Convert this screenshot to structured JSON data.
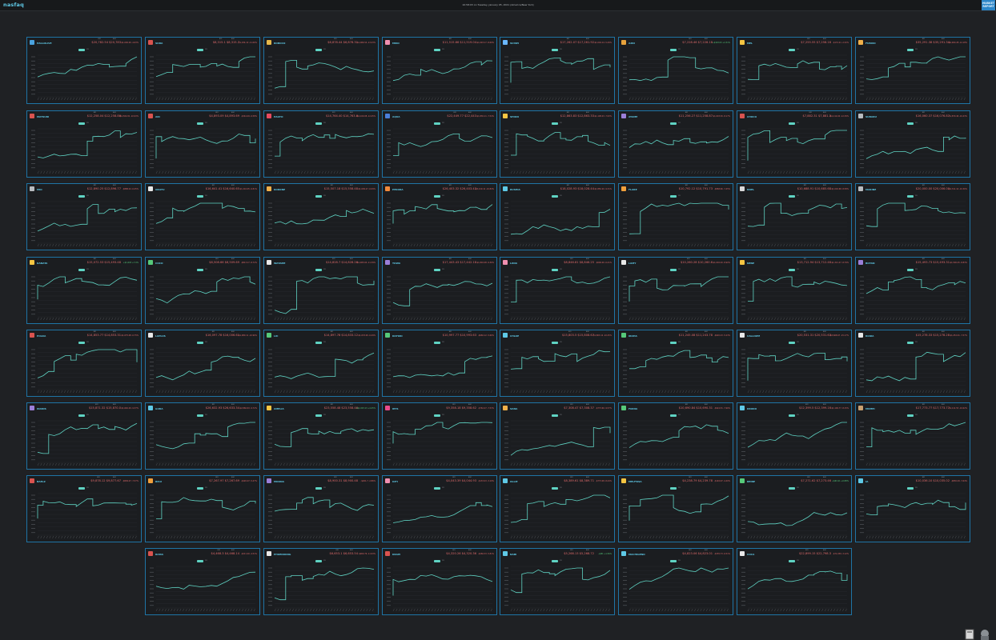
{
  "app": {
    "logo": "nasfaq",
    "timestamp": "10:58:03 on Tuesday, January 05, 2021 (America/New York)",
    "market_button": "MARKET REPORT",
    "colors": {
      "accent": "#5fc9e6",
      "line": "#5fd3c3",
      "down": "#e06b6b",
      "up": "#56c97a",
      "border": "#1f74a5"
    }
  },
  "cards": [
    {
      "name": "HALLOLIVE",
      "icon": "play-icon",
      "color": "#4aa3df",
      "p1": "$20,782.54",
      "p2": "$20,783",
      "chg": "-$1,000.00 -4.63%",
      "up": false
    },
    {
      "name": "SORA",
      "icon": "bear-icon",
      "color": "#d9534f",
      "p1": "$8,315.1",
      "p2": "$8,315.7",
      "chg": "-$1,034.10 -11.06%",
      "up": false
    },
    {
      "name": "ROBOCO",
      "icon": "robot-icon",
      "color": "#e6b84a",
      "p1": "$6,878.44",
      "p2": "$6,878.31",
      "chg": "-$1,066.54 -13.43%",
      "up": false
    },
    {
      "name": "MIKO",
      "icon": "flower-icon",
      "color": "#f08fb0",
      "p1": "$11,515.66",
      "p2": "$11,519.04",
      "chg": "-$1,093.17 -8.69%",
      "up": false
    },
    {
      "name": "SUISEI",
      "icon": "comet-icon",
      "color": "#6ab7ff",
      "p1": "$17,262.07",
      "p2": "$17,261.92",
      "chg": "-$1,004.14 -5.49%",
      "up": false
    },
    {
      "name": "AZKI",
      "icon": "pickaxe-icon",
      "color": "#e6a23c",
      "p1": "$7,228.46",
      "p2": "$7,228.18",
      "chg": "+$163.03 +2.31%",
      "up": true
    },
    {
      "name": "MEL",
      "icon": "sun-icon",
      "color": "#f5c542",
      "p1": "$7,255.55",
      "p2": "$7,258.16",
      "chg": "-$172.21 -2.32%",
      "up": false
    },
    {
      "name": "FUBUKI",
      "icon": "fox-icon",
      "color": "#f0b04a",
      "p1": "$35,291.38",
      "p2": "$35,291.34",
      "chg": "-$4,900.28 -12.18%",
      "up": false
    },
    {
      "name": "MATSURI",
      "icon": "festival-icon",
      "color": "#d9534f",
      "p1": "$12,258.04",
      "p2": "$12,258.86",
      "chg": "-$1,504.81 -10.93%",
      "up": false
    },
    {
      "name": "AKI",
      "icon": "leaf-icon",
      "color": "#d9534f",
      "p1": "$4,893.09",
      "p2": "$4,893.69",
      "chg": "-$344.49 -6.58%",
      "up": false
    },
    {
      "name": "HAATO",
      "icon": "heart-icon",
      "color": "#e84a5f",
      "p1": "$14,764.40",
      "p2": "$14,763.6",
      "chg": "-$2,100.08 -12.45%",
      "up": false
    },
    {
      "name": "AQUA",
      "icon": "anchor-icon",
      "color": "#4a7fd9",
      "p1": "$22,449.77",
      "p2": "$22,443",
      "chg": "-$1,830.11 -7.54%",
      "up": false
    },
    {
      "name": "SHION",
      "icon": "moon-icon",
      "color": "#f5c542",
      "p1": "$12,863.83",
      "p2": "$12,863.33",
      "chg": "-$1,108.43 -7.93%",
      "up": false
    },
    {
      "name": "AYAME",
      "icon": "mask-icon",
      "color": "#9b7fd9",
      "p1": "$11,256.27",
      "p2": "$11,258.87",
      "chg": "-$1,003.30 -8.17%",
      "up": false
    },
    {
      "name": "CHOCO",
      "icon": "lips-icon",
      "color": "#d9534f",
      "p1": "$7,882.31",
      "p2": "$7,881.5",
      "chg": "-$1,114.60 -12.39%",
      "up": false
    },
    {
      "name": "SUBARU",
      "icon": "duck-icon",
      "color": "#b8bcc0",
      "p1": "$16,060.37",
      "p2": "$16,076.87",
      "chg": "-$1,870.46 -10.43%",
      "up": false
    },
    {
      "name": "MIO",
      "icon": "wolf-icon",
      "color": "#b8bcc0",
      "p1": "$12,890.25",
      "p2": "$12,896.77",
      "chg": "-$888.24 -6.45%",
      "up": false
    },
    {
      "name": "OKAYU",
      "icon": "onigiri-icon",
      "color": "#e8e8e8",
      "p1": "$16,641.41",
      "p2": "$16,640.65",
      "chg": "-$1,216.05 -6.81%",
      "up": false
    },
    {
      "name": "KORONE",
      "icon": "croissant-icon",
      "color": "#f0b04a",
      "p1": "$15,507.18",
      "p2": "$15,558.48",
      "chg": "-$1,009.27 -6.09%",
      "up": false
    },
    {
      "name": "PEKORA",
      "icon": "carrot-icon",
      "color": "#f08a3c",
      "p1": "$26,403.32",
      "p2": "$26,403.43",
      "chg": "-$3,210.12 -10.84%",
      "up": false
    },
    {
      "name": "RUSHIA",
      "icon": "butterfly-icon",
      "color": "#5fc9e6",
      "p1": "$18,028.93",
      "p2": "$18,028.44",
      "chg": "-$1,850.20 -9.31%",
      "up": false
    },
    {
      "name": "FLARE",
      "icon": "flame-icon",
      "color": "#f0a03c",
      "p1": "$10,792.12",
      "p2": "$10,791.73",
      "chg": "-$868.66 -7.45%",
      "up": false
    },
    {
      "name": "NOEL",
      "icon": "swords-icon",
      "color": "#d8d8d8",
      "p1": "$10,688.91",
      "p2": "$10,685.68",
      "chg": "-$1,002.68 -8.58%",
      "up": false
    },
    {
      "name": "MARINE",
      "icon": "pirate-icon",
      "color": "#b8bcc0",
      "p1": "$20,000.00",
      "p2": "$20,006.00",
      "chg": "-$2,311.14 -10.36%",
      "up": false
    },
    {
      "name": "KANATA",
      "icon": "wing-icon",
      "color": "#f5c542",
      "p1": "$15,072.53",
      "p2": "$15,493.48",
      "chg": "+$1,003 +7.0%",
      "up": true
    },
    {
      "name": "COCO",
      "icon": "dragon-icon",
      "color": "#56c97a",
      "p1": "$8,508.66",
      "p2": "$8,509.69",
      "chg": "-$813.17 -8.72%",
      "up": false
    },
    {
      "name": "WATAME",
      "icon": "sheep-icon",
      "color": "#e8e8e8",
      "p1": "$14,828.7",
      "p2": "$14,828.26",
      "chg": "-$1,905.60 -11.39%",
      "up": false
    },
    {
      "name": "TOWA",
      "icon": "devil-icon",
      "color": "#9b7fd9",
      "p1": "$17,443.43",
      "p2": "$17,442.18",
      "chg": "-$1,802.08 -9.36%",
      "up": false
    },
    {
      "name": "LUNA",
      "icon": "candy-icon",
      "color": "#f08fb0",
      "p1": "$8,846.81",
      "p2": "$8,846.25",
      "chg": "-$606.00 -6.41%",
      "up": false
    },
    {
      "name": "LAMY",
      "icon": "snowman-icon",
      "color": "#e8e8e8",
      "p1": "$10,260.28",
      "p2": "$10,260.6",
      "chg": "-$1,002.20 -8.90%",
      "up": false
    },
    {
      "name": "NENE",
      "icon": "bread-icon",
      "color": "#f5c542",
      "p1": "$13,712.94",
      "p2": "$13,712.46",
      "chg": "-$1,321.47 -8.79%",
      "up": false
    },
    {
      "name": "BOTAN",
      "icon": "lion-icon",
      "color": "#9b7fd9",
      "p1": "$15,493.73",
      "p2": "$15,493.31",
      "chg": "-$1,500.25 -8.83%",
      "up": false
    },
    {
      "name": "POLKA",
      "icon": "circus-icon",
      "color": "#d9534f",
      "p1": "$14,853.77",
      "p2": "$14,853.31",
      "chg": "-$1,075.08 -6.75%",
      "up": false
    },
    {
      "name": "LAPLUS",
      "icon": "hat-icon",
      "color": "#e8e8e8",
      "p1": "$16,097.78",
      "p2": "$16,006.61",
      "chg": "-$1,980.11 -10.96%",
      "up": false
    },
    {
      "name": "LUI",
      "icon": "bow-icon",
      "color": "#56c97a",
      "p1": "$14,897.78",
      "p2": "$14,833.12",
      "chg": "-$1,033.00 -6.49%",
      "up": false
    },
    {
      "name": "KOYORI",
      "icon": "syringe-icon",
      "color": "#56c97a",
      "p1": "$10,997.77",
      "p2": "$10,993.63",
      "chg": "-$660.12 -5.66%",
      "up": false
    },
    {
      "name": "CHLOE",
      "icon": "star-icon",
      "color": "#5fc9e6",
      "p1": "$15,803.5",
      "p2": "$15,808.67",
      "chg": "-$1,803.12 -10.25%",
      "up": false
    },
    {
      "name": "IROHA",
      "icon": "leaf2-icon",
      "color": "#56c97a",
      "p1": "$11,245.08",
      "p2": "$11,243.78",
      "chg": "-$620.23 -5.23%",
      "up": false
    },
    {
      "name": "CALLIOPE",
      "icon": "skull-icon",
      "color": "#e8e8e8",
      "p1": "$20,531.31",
      "p2": "$20,531.63",
      "chg": "-$3,668.67 -15.17%",
      "up": false
    },
    {
      "name": "KIARA",
      "icon": "chicken-icon",
      "color": "#e8e8e8",
      "p1": "$15,278.33",
      "p2": "$15,278.28",
      "chg": "-$1,252.01 -7.57%",
      "up": false
    },
    {
      "name": "INANIS",
      "icon": "octopus-icon",
      "color": "#9b7fd9",
      "p1": "$15,871.32",
      "p2": "$15,870.0",
      "chg": "-$1,640.29 -9.37%",
      "up": false
    },
    {
      "name": "GURA",
      "icon": "shark-icon",
      "color": "#5fc9e6",
      "p1": "$26,632.93",
      "p2": "$26,633.34",
      "chg": "-$2,866.63 -9.72%",
      "up": false
    },
    {
      "name": "AMELIA",
      "icon": "magnifier-icon",
      "color": "#f5c542",
      "p1": "$23,558.48",
      "p2": "$23,558.46",
      "chg": "+$1,003.13 +4.45%",
      "up": true
    },
    {
      "name": "IRYS",
      "icon": "gem-icon",
      "color": "#e84a8a",
      "p1": "$9,358.18",
      "p2": "$9,358.62",
      "chg": "-$762.27 -7.53%",
      "up": false
    },
    {
      "name": "SANA",
      "icon": "planet-icon",
      "color": "#f0b04a",
      "p1": "$7,308.47",
      "p2": "$7,308.37",
      "chg": "-$773.60 -9.57%",
      "up": false
    },
    {
      "name": "FAUNA",
      "icon": "sprout-icon",
      "color": "#56c97a",
      "p1": "$10,690.84",
      "p2": "$10,690.31",
      "chg": "-$924.51 -7.96%",
      "up": false
    },
    {
      "name": "KRONII",
      "icon": "hourglass-icon",
      "color": "#5fc9e6",
      "p1": "$12,399.5",
      "p2": "$12,399.16",
      "chg": "-$1,100.77 -8.15%",
      "up": false
    },
    {
      "name": "MUMEI",
      "icon": "feather-icon",
      "color": "#c8a070",
      "p1": "$17,773.77",
      "p2": "$17,773.77",
      "chg": "-$2,111.53 -10.62%",
      "up": false
    },
    {
      "name": "BAELZ",
      "icon": "dice-icon",
      "color": "#d9534f",
      "p1": "$9,878.12",
      "p2": "$9,877.67",
      "chg": "-$809.07 -7.57%",
      "up": false
    },
    {
      "name": "RISU",
      "icon": "squirrel-icon",
      "color": "#f0a03c",
      "p1": "$7,267.97",
      "p2": "$7,267.69",
      "chg": "-$420.07 -5.47%",
      "up": false
    },
    {
      "name": "MOONA",
      "icon": "moon2-icon",
      "color": "#9b7fd9",
      "p1": "$8,900.31",
      "p2": "$8,900.48",
      "chg": "-$261.7 -2.86%",
      "up": false
    },
    {
      "name": "IOFI",
      "icon": "paint-icon",
      "color": "#f08fb0",
      "p1": "$4,043.39",
      "p2": "$4,044.93",
      "chg": "-$133.43 -3.19%",
      "up": false
    },
    {
      "name": "OLLIE",
      "icon": "zombie-icon",
      "color": "#5fc9e6",
      "p1": "$8,389.61",
      "p2": "$8,389.71",
      "chg": "-$773.48 -8.44%",
      "up": false
    },
    {
      "name": "MELFISSA",
      "icon": "wings-icon",
      "color": "#f5c542",
      "p1": "$4,238.79",
      "p2": "$4,239.78",
      "chg": "-$194.97 -4.40%",
      "up": false
    },
    {
      "name": "REINE",
      "icon": "peacock-icon",
      "color": "#56c97a",
      "p1": "$7,271.62",
      "p2": "$7,273.46",
      "chg": "+$63.21 +0.88%",
      "up": true
    },
    {
      "name": "IA",
      "icon": "music-icon",
      "color": "#5fc9e6",
      "p1": "$10,036.10",
      "p2": "$10,035.02",
      "chg": "-$830.29 -7.64%",
      "up": false
    },
    {
      "name": "RAMA",
      "icon": "chili-icon",
      "color": "#d9534f",
      "p1": "$4,468.3",
      "p2": "$4,468.14",
      "chg": "-$211.20 -4.51%",
      "up": false
    },
    {
      "name": "PHOENIXING",
      "icon": "glasses-icon",
      "color": "#e8e8e8",
      "p1": "$6,653.1",
      "p2": "$6,653.54",
      "chg": "-$900.79 -11.93%",
      "up": false
    },
    {
      "name": "KRAPI",
      "icon": "pen-icon",
      "color": "#d9534f",
      "p1": "$4,320.26",
      "p2": "$4,320.36",
      "chg": "-$266.33 -5.81%",
      "up": false
    },
    {
      "name": "NABI",
      "icon": "brush-icon",
      "color": "#5fc9e6",
      "p1": "$5,268.13",
      "p2": "$5,268.72",
      "chg": "+$81 +1.56%",
      "up": true
    },
    {
      "name": "MACHIGENO",
      "icon": "paw-icon",
      "color": "#5fc9e6",
      "p1": "$4,823.06",
      "p2": "$4,823.01",
      "chg": "-$335.73 -6.51%",
      "up": false
    },
    {
      "name": "COCA",
      "icon": "horse-icon",
      "color": "#e8e8e8",
      "p1": "$22,899.15",
      "p2": "$22,798.3",
      "chg": "-$71,039 -3.12%",
      "up": false
    }
  ],
  "labels": {
    "bid": "BID",
    "ask": "ASK",
    "toggle": "1D"
  }
}
